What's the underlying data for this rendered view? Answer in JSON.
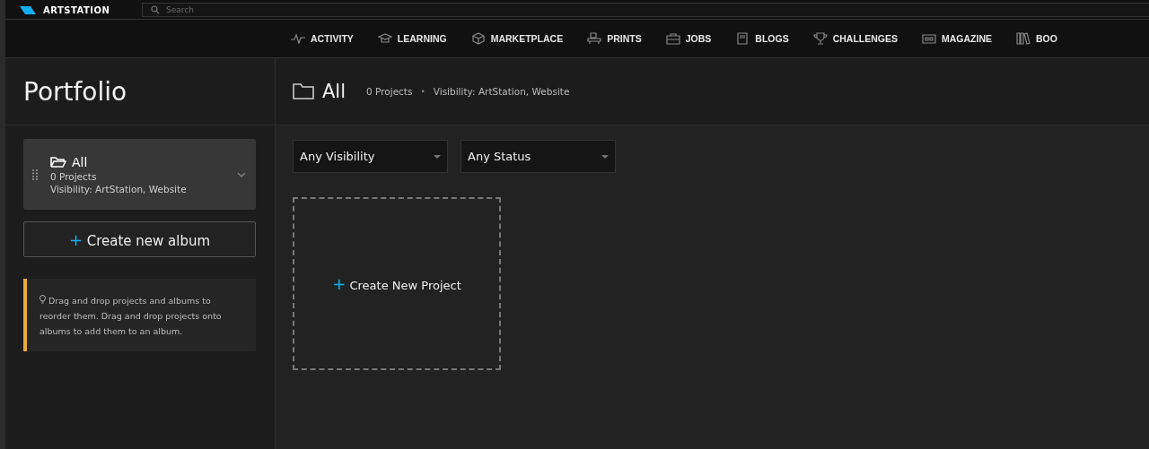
{
  "header": {
    "logo": "ARTSTATION",
    "search": {
      "placeholder": "Search"
    }
  },
  "nav": [
    {
      "kind": "activity",
      "label": "ACTIVITY"
    },
    {
      "kind": "learning",
      "label": "LEARNING"
    },
    {
      "kind": "marketplace",
      "label": "MARKETPLACE"
    },
    {
      "kind": "prints",
      "label": "PRINTS"
    },
    {
      "kind": "jobs",
      "label": "JOBS"
    },
    {
      "kind": "blogs",
      "label": "BLOGS"
    },
    {
      "kind": "challenges",
      "label": "CHALLENGES"
    },
    {
      "kind": "magazine",
      "label": "MAGAZINE"
    },
    {
      "kind": "books",
      "label": "BOO"
    }
  ],
  "sidebar": {
    "title": "Portfolio",
    "albums": [
      {
        "name": "All",
        "count": "0 Projects",
        "visibility": "Visibility: ArtStation, Website",
        "selected": true
      }
    ],
    "create_album": {
      "icon": "+",
      "label": "Create new album"
    },
    "tip": "Drag and drop projects and albums to reorder them. Drag and drop projects onto albums to add them to an album."
  },
  "main": {
    "title": "All",
    "count": "0 Projects",
    "separator": "•",
    "visibility": "Visibility: ArtStation, Website",
    "filters": [
      {
        "value": "Any Visibility"
      },
      {
        "value": "Any Status"
      }
    ],
    "create_project": {
      "icon": "+",
      "label": "Create New Project"
    }
  }
}
